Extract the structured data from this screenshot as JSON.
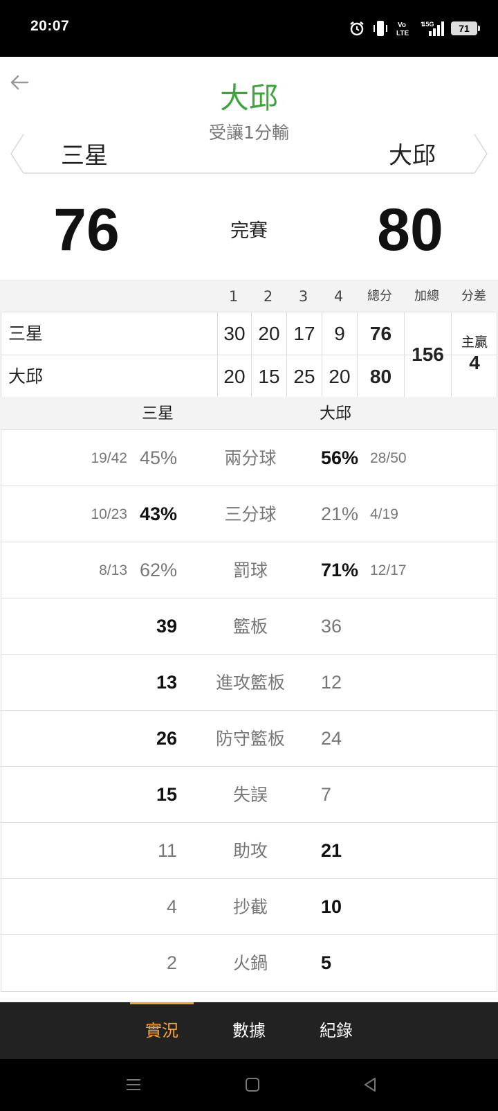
{
  "status_bar": {
    "time": "20:07",
    "battery": "71",
    "icons": [
      "alarm-icon",
      "vibrate-icon",
      "volte-icon",
      "5g-signal-icon",
      "battery-icon"
    ]
  },
  "header": {
    "winner": "大邱",
    "handicap_text": "受讓1分輸",
    "home_team": "三星",
    "away_team": "大邱",
    "home_score": "76",
    "away_score": "80",
    "game_status": "完賽"
  },
  "quarter_table": {
    "columns": [
      "1",
      "2",
      "3",
      "4",
      "總分",
      "加總",
      "分差"
    ],
    "rows": [
      {
        "team": "三星",
        "quarters": [
          "30",
          "20",
          "17",
          "9"
        ],
        "total": "76"
      },
      {
        "team": "大邱",
        "quarters": [
          "20",
          "15",
          "25",
          "20"
        ],
        "total": "80"
      }
    ],
    "combined_total": "156",
    "diff_label": "主贏",
    "diff_value": "4"
  },
  "stats": {
    "home_team": "三星",
    "away_team": "大邱",
    "rows": [
      {
        "label": "兩分球",
        "home_frac": "19/42",
        "home": "45%",
        "away": "56%",
        "away_frac": "28/50",
        "winner": "away"
      },
      {
        "label": "三分球",
        "home_frac": "10/23",
        "home": "43%",
        "away": "21%",
        "away_frac": "4/19",
        "winner": "home"
      },
      {
        "label": "罰球",
        "home_frac": "8/13",
        "home": "62%",
        "away": "71%",
        "away_frac": "12/17",
        "winner": "away"
      },
      {
        "label": "籃板",
        "home_frac": "",
        "home": "39",
        "away": "36",
        "away_frac": "",
        "winner": "home"
      },
      {
        "label": "進攻籃板",
        "home_frac": "",
        "home": "13",
        "away": "12",
        "away_frac": "",
        "winner": "home"
      },
      {
        "label": "防守籃板",
        "home_frac": "",
        "home": "26",
        "away": "24",
        "away_frac": "",
        "winner": "home"
      },
      {
        "label": "失誤",
        "home_frac": "",
        "home": "15",
        "away": "7",
        "away_frac": "",
        "winner": "home"
      },
      {
        "label": "助攻",
        "home_frac": "",
        "home": "11",
        "away": "21",
        "away_frac": "",
        "winner": "away"
      },
      {
        "label": "抄截",
        "home_frac": "",
        "home": "4",
        "away": "10",
        "away_frac": "",
        "winner": "away"
      },
      {
        "label": "火鍋",
        "home_frac": "",
        "home": "2",
        "away": "5",
        "away_frac": "",
        "winner": "away"
      }
    ]
  },
  "tabs": [
    {
      "label": "實況",
      "active": true
    },
    {
      "label": "數據",
      "active": false
    },
    {
      "label": "紀錄",
      "active": false
    }
  ],
  "nav_bar": [
    "menu-icon",
    "home-icon",
    "back-triangle-icon"
  ],
  "colors": {
    "winner_green": "#3aa53a",
    "tab_active": "#f5a431",
    "tab_bar_bg": "#222222"
  }
}
